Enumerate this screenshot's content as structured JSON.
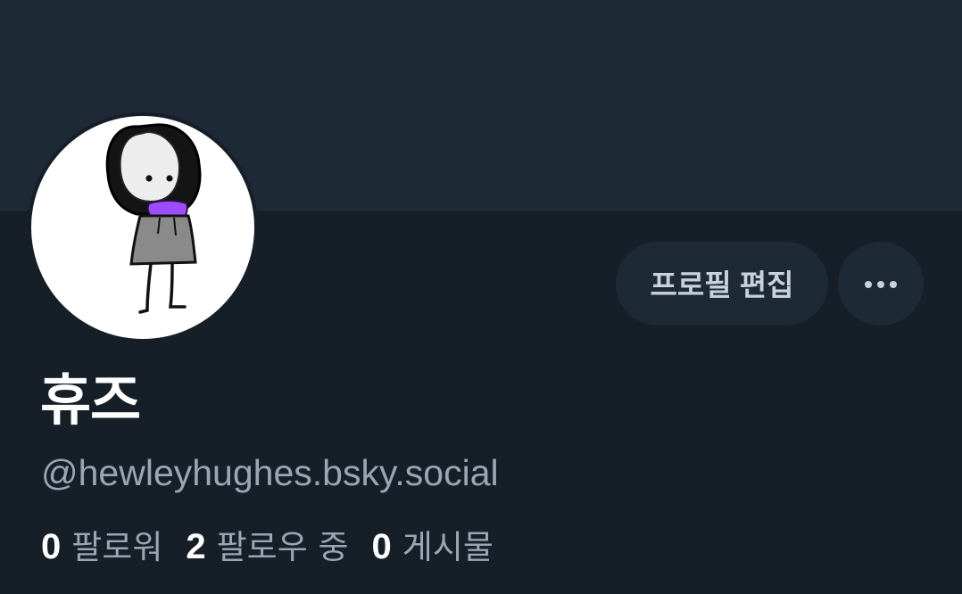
{
  "profile": {
    "display_name": "휴즈",
    "handle": "@hewleyhughes.bsky.social",
    "avatar_icon": "stick-figure-avatar"
  },
  "actions": {
    "edit_label": "프로필 편집",
    "more_icon": "ellipsis-icon"
  },
  "stats": [
    {
      "value": "0",
      "label": "팔로워"
    },
    {
      "value": "2",
      "label": "팔로우 중"
    },
    {
      "value": "0",
      "label": "게시물"
    }
  ],
  "colors": {
    "background": "#161e27",
    "banner": "#1e2936",
    "button": "#1e2936",
    "text_primary": "#ffffff",
    "text_secondary": "#9aa6b4",
    "avatar_accent": "#9b4dff"
  }
}
